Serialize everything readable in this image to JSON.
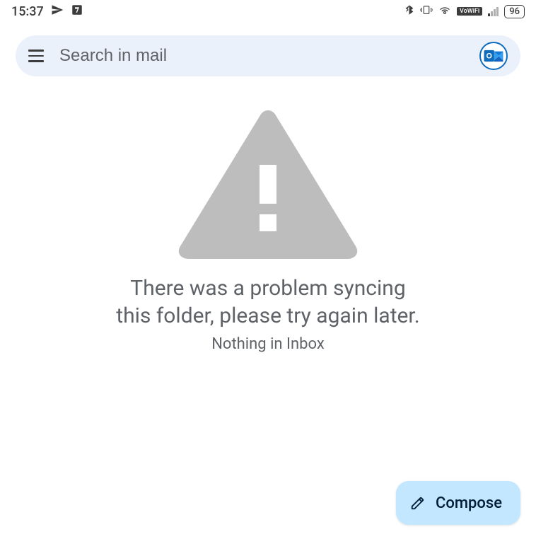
{
  "statusbar": {
    "time": "15:37",
    "battery": "96",
    "vowifi": "VoWiFi"
  },
  "search": {
    "placeholder": "Search in mail"
  },
  "main": {
    "error_message": "There was a problem syncing this folder, please try again later.",
    "sub_message": "Nothing in Inbox"
  },
  "fab": {
    "compose_label": "Compose"
  }
}
